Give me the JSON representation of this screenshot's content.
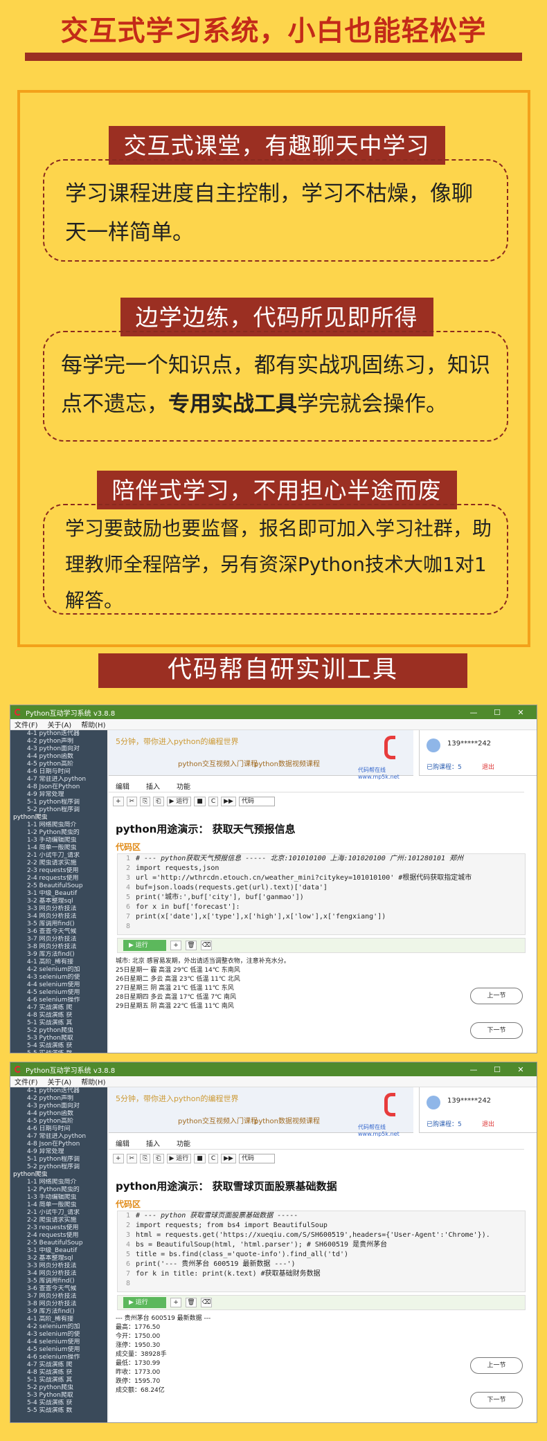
{
  "hero": {
    "title": "交互式学习系统，小白也能轻松学"
  },
  "sections": [
    {
      "title": "交互式课堂，有趣聊天中学习",
      "body": "学习课程进度自主控制，学习不枯燥，像聊天一样简单。"
    },
    {
      "title": "边学边练，代码所见即所得",
      "body_pre": "每学完一个知识点，都有实战巩固练习，知识点不遗忘，",
      "body_bold": "专用实战工具",
      "body_post": "学完就会操作。"
    },
    {
      "title": "陪伴式学习，不用担心半途而废",
      "body": "学习要鼓励也要监督，报名即可加入学习社群，助理教师全程陪学，另有资深Python技术大咖1对1解答。"
    }
  ],
  "tool_banner": "代码帮自研实训工具",
  "windows": [
    {
      "title": "Python互动学习系统 v3.8.8",
      "controls": [
        "—",
        "☐",
        "✕"
      ],
      "menu": [
        "文件(F)",
        "关于(A)",
        "帮助(H)"
      ],
      "sidebar": [
        "4-1 python迭代器",
        "4-2 python声明",
        "4-3 python面向对",
        "4-4 python函数",
        "4-5 python高阶",
        "4-6 日期与时间",
        "4-7 常驻进入python",
        "4-8 Json在Python",
        "4-9 异常处理",
        "5-1 python程序调",
        "5-2 python程序调",
        "python爬虫",
        "1-1 网络爬虫简介",
        "1-2 Python爬虫的",
        "1-3 手动编辑爬虫",
        "1-4 简单一般爬虫",
        "2-1 小试牛刀_请求",
        "2-2 爬虫请求实施",
        "2-3 requests使用",
        "2-4 requests使用",
        "2-5 BeautifulSoup",
        "3-1 中级_Beautif",
        "3-2 基本整理sql",
        "3-3 网页分析技法",
        "3-4 网页分析技法",
        "3-5 库调用find()",
        "3-6 查查今天气候",
        "3-7 网页分析技法",
        "3-8 网页分析技法",
        "3-9 库方法find()",
        "4-1 高阶_稀有接",
        "4-2 selenium的加",
        "4-3 selenium的使",
        "4-4 selenium使用",
        "4-5 selenium使用",
        "4-6 selenium操作",
        "4-7 实战演练 爬",
        "4-8 实战演练 获",
        "5-1 实战演练 其",
        "5-2 python爬虫",
        "5-3 Python爬取",
        "5-4 实战演练 获",
        "5-5 实战演练 数"
      ],
      "ad": {
        "line1": "5分钟，带你进入python的编程世界",
        "line2": "python交互视频入门课程",
        "line3": "python数据视频课程",
        "line4": "代码帮在线 www.mp5k.net"
      },
      "user": {
        "phone": "139*****242",
        "course": "已购课程：5",
        "logout": "退出"
      },
      "tabs": [
        "编辑",
        "插入",
        "功能"
      ],
      "toolbar": {
        "buttons": [
          "+",
          "✂",
          "⎘",
          "⎗",
          "▶ 运行",
          "■",
          "C",
          "▶▶"
        ],
        "select": "代码"
      },
      "heading": "python用途演示： 获取天气预报信息",
      "code_label": "代码区",
      "code": [
        {
          "n": "1",
          "text": "# --- python获取天气预报信息 -----  北京:101010100  上海:101020100  广州:101280101  郑州",
          "comment": true
        },
        {
          "n": "2",
          "text": "import requests,json",
          "comment": false
        },
        {
          "n": "3",
          "text": "url ='http://wthrcdn.etouch.cn/weather_mini?citykey=101010100'   #根据代码获取指定城市",
          "comment": false
        },
        {
          "n": "4",
          "text": "buf=json.loads(requests.get(url).text)['data']",
          "comment": false
        },
        {
          "n": "5",
          "text": "print('城市:',buf['city'], buf['ganmao'])",
          "comment": false
        },
        {
          "n": "6",
          "text": "for x in buf['forecast']:",
          "comment": false
        },
        {
          "n": "7",
          "text": "    print(x['date'],x['type'],x['high'],x['low'],x['fengxiang'])",
          "comment": false
        },
        {
          "n": "8",
          "text": "",
          "comment": false
        }
      ],
      "run_label": "▶ 运行",
      "output": [
        "城市: 北京 感冒易发期，外出请适当调整衣物，注意补充水分。",
        "25日星期一 霾 高温 29℃ 低温 14℃ 东南风",
        "26日星期二 多云 高温 23℃ 低温 11℃ 北风",
        "27日星期三 阴 高温 21℃ 低温 11℃ 东风",
        "28日星期四 多云 高温 17℃ 低温 7℃ 南风",
        "29日星期五 阴 高温 22℃ 低温 11℃ 南风"
      ],
      "prev": "上一节",
      "next": "下一节"
    },
    {
      "title": "Python互动学习系统 v3.8.8",
      "controls": [
        "—",
        "☐",
        "✕"
      ],
      "menu": [
        "文件(F)",
        "关于(A)",
        "帮助(H)"
      ],
      "sidebar": [
        "4-1 python迭代器",
        "4-2 python声明",
        "4-3 python面向对",
        "4-4 python函数",
        "4-5 python高阶",
        "4-6 日期与时间",
        "4-7 常驻进入python",
        "4-8 Json在Python",
        "4-9 异常处理",
        "5-1 python程序调",
        "5-2 python程序调",
        "python爬虫",
        "1-1 网络爬虫简介",
        "1-2 Python爬虫的",
        "1-3 手动编辑爬虫",
        "1-4 简单一般爬虫",
        "2-1 小试牛刀_请求",
        "2-2 爬虫请求实施",
        "2-3 requests使用",
        "2-4 requests使用",
        "2-5 BeautifulSoup",
        "3-1 中级_Beautif",
        "3-2 基本整理sql",
        "3-3 网页分析技法",
        "3-4 网页分析技法",
        "3-5 库调用find()",
        "3-6 查查今天气候",
        "3-7 网页分析技法",
        "3-8 网页分析技法",
        "3-9 库方法find()",
        "4-1 高阶_稀有接",
        "4-2 selenium的加",
        "4-3 selenium的使",
        "4-4 selenium使用",
        "4-5 selenium使用",
        "4-6 selenium操作",
        "4-7 实战演练 爬",
        "4-8 实战演练 获",
        "5-1 实战演练 其",
        "5-2 python爬虫",
        "5-3 Python爬取",
        "5-4 实战演练 获",
        "5-5 实战演练 数"
      ],
      "ad": {
        "line1": "5分钟，带你进入python的编程世界",
        "line2": "python交互视频入门课程",
        "line3": "python数据视频课程",
        "line4": "代码帮在线 www.mp5k.net"
      },
      "user": {
        "phone": "139*****242",
        "course": "已购课程：5",
        "logout": "退出"
      },
      "tabs": [
        "编辑",
        "插入",
        "功能"
      ],
      "toolbar": {
        "buttons": [
          "+",
          "✂",
          "⎘",
          "⎗",
          "▶ 运行",
          "■",
          "C",
          "▶▶"
        ],
        "select": "代码"
      },
      "heading": "python用途演示： 获取雪球页面股票基础数据",
      "code_label": "代码区",
      "code": [
        {
          "n": "1",
          "text": "# --- python 获取雪球页面股票基础数据 -----",
          "comment": true
        },
        {
          "n": "2",
          "text": "import requests;  from bs4 import BeautifulSoup",
          "comment": false
        },
        {
          "n": "3",
          "text": "html = requests.get('https://xueqiu.com/S/SH600519',headers={'User-Agent':'Chrome'}).",
          "comment": false
        },
        {
          "n": "4",
          "text": "bs = BeautifulSoup(html, 'html.parser');   # SH600519 是贵州茅台",
          "comment": false
        },
        {
          "n": "5",
          "text": "title = bs.find(class_='quote-info').find_all('td')",
          "comment": false
        },
        {
          "n": "6",
          "text": "print('--- 贵州茅台 600519 最新数据 ---')",
          "comment": false
        },
        {
          "n": "7",
          "text": "for k in title: print(k.text)     #获取基础财务数据",
          "comment": false
        },
        {
          "n": "8",
          "text": "",
          "comment": false
        }
      ],
      "run_label": "▶ 运行",
      "output": [
        "--- 贵州茅台 600519 最新数据 ---",
        "最高：1776.50",
        "今开：1750.00",
        "涨停：1950.30",
        "成交量：38928手",
        "最低：1730.99",
        "昨收：1773.00",
        "跌停：1595.70",
        "成交额：68.24亿"
      ],
      "prev": "上一节",
      "next": "下一节"
    }
  ]
}
